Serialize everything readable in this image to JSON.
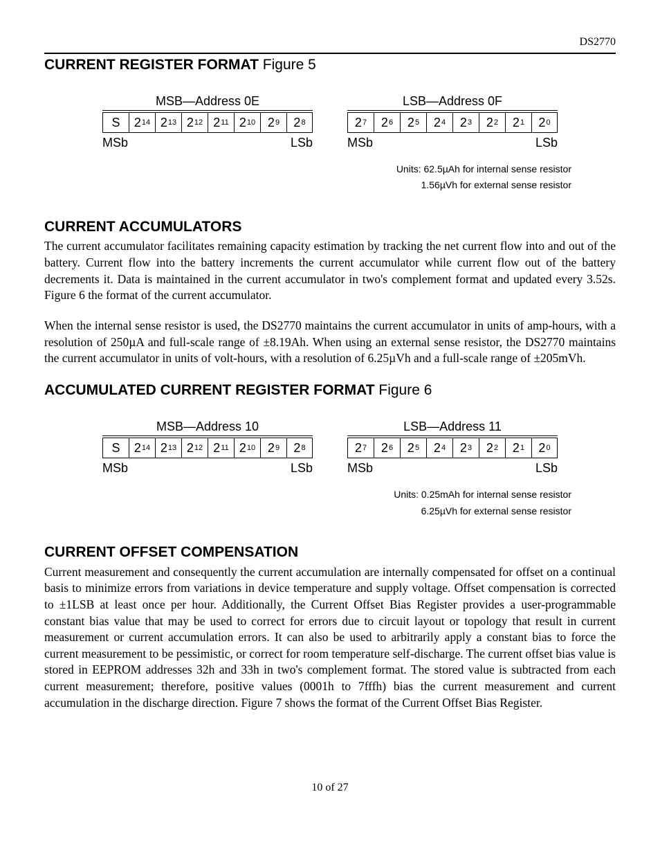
{
  "chip": "DS2770",
  "fig5": {
    "title_bold": "CURRENT REGISTER FORMAT",
    "title_thin": " Figure 5",
    "msb_label": "MSB—Address 0E",
    "lsb_label": "LSB—Address 0F",
    "msb_bits": [
      "S",
      "14",
      "13",
      "12",
      "11",
      "10",
      "9",
      "8"
    ],
    "lsb_bits": [
      "7",
      "6",
      "5",
      "4",
      "3",
      "2",
      "1",
      "0"
    ],
    "msb_left": "MSb",
    "msb_right": "LSb",
    "units1": "Units: 62.5µAh for internal sense resistor",
    "units2": "1.56µVh for external sense resistor"
  },
  "sec_acc": {
    "heading": "CURRENT ACCUMULATORS",
    "p1": "The current accumulator facilitates remaining capacity estimation by tracking the net current flow into and out of the battery. Current flow into the battery increments the current accumulator while current flow out of the battery decrements it. Data is maintained in the current accumulator in two's complement format and updated every 3.52s. Figure 6 the format of the current accumulator.",
    "p2": "When the internal sense resistor is used, the DS2770 maintains the current accumulator in units of amp-hours, with a resolution of 250µA and full-scale range of ±8.19Ah. When using an external sense resistor, the DS2770 maintains the current accumulator in units of volt-hours, with a resolution of 6.25µVh and a full-scale range of ±205mVh."
  },
  "fig6": {
    "title_bold": "ACCUMULATED CURRENT REGISTER FORMAT",
    "title_thin": " Figure 6",
    "msb_label": "MSB—Address 10",
    "lsb_label": "LSB—Address 11",
    "msb_bits": [
      "S",
      "14",
      "13",
      "12",
      "11",
      "10",
      "9",
      "8"
    ],
    "lsb_bits": [
      "7",
      "6",
      "5",
      "4",
      "3",
      "2",
      "1",
      "0"
    ],
    "msb_left": "MSb",
    "msb_right": "LSb",
    "units1": "Units: 0.25mAh for internal sense resistor",
    "units2": "6.25µVh for external sense resistor"
  },
  "sec_off": {
    "heading": "CURRENT OFFSET COMPENSATION",
    "p1": "Current measurement and consequently the current accumulation are internally compensated for offset on a continual basis to minimize errors from variations in device temperature and supply voltage. Offset compensation is corrected to ±1LSB at least once per hour. Additionally, the Current Offset Bias Register provides a user-programmable constant bias value that may be used to correct for errors due to circuit layout or topology that result in current measurement or current accumulation errors. It can also be used to arbitrarily apply a constant bias to force the current measurement to be pessimistic, or correct for room temperature self-discharge. The current offset bias value is stored in EEPROM addresses 32h and 33h in two's complement format. The stored value is subtracted from each current measurement; therefore, positive values (0001h to 7fffh) bias the current measurement and current accumulation in the discharge direction. Figure 7 shows the format of the Current Offset Bias Register."
  },
  "page": "10 of 27"
}
